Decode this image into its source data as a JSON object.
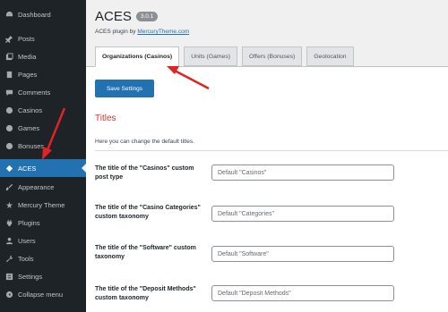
{
  "sidebar": {
    "items": [
      {
        "label": "Dashboard",
        "icon": "dashboard-icon",
        "active": false
      },
      {
        "label": "Posts",
        "icon": "pin-icon",
        "active": false
      },
      {
        "label": "Media",
        "icon": "media-icon",
        "active": false
      },
      {
        "label": "Pages",
        "icon": "pages-icon",
        "active": false
      },
      {
        "label": "Comments",
        "icon": "comments-icon",
        "active": false
      },
      {
        "label": "Casinos",
        "icon": "casinos-icon",
        "active": false
      },
      {
        "label": "Games",
        "icon": "games-icon",
        "active": false
      },
      {
        "label": "Bonuses",
        "icon": "bonuses-icon",
        "active": false
      },
      {
        "label": "ACES",
        "icon": "aces-icon",
        "active": true
      },
      {
        "label": "Appearance",
        "icon": "appearance-icon",
        "active": false
      },
      {
        "label": "Mercury Theme",
        "icon": "mercury-icon",
        "active": false
      },
      {
        "label": "Plugins",
        "icon": "plugins-icon",
        "active": false
      },
      {
        "label": "Users",
        "icon": "users-icon",
        "active": false
      },
      {
        "label": "Tools",
        "icon": "tools-icon",
        "active": false
      },
      {
        "label": "Settings",
        "icon": "settings-icon",
        "active": false
      },
      {
        "label": "Collapse menu",
        "icon": "collapse-icon",
        "active": false
      }
    ]
  },
  "header": {
    "title": "ACES",
    "version": "3.0.1",
    "byline_prefix": "ACES plugin by ",
    "byline_link": "MercuryTheme.com"
  },
  "tabs": [
    {
      "label": "Organizations (Casinos)",
      "active": true
    },
    {
      "label": "Units (Games)",
      "active": false
    },
    {
      "label": "Offers (Bonuses)",
      "active": false
    },
    {
      "label": "Geolocation",
      "active": false
    }
  ],
  "save_button": "Save Settings",
  "section": {
    "title": "Titles",
    "description": "Here you can change the default titles."
  },
  "rows": [
    {
      "label": "The title of the \"Casinos\" custom post type",
      "value": "Default \"Casinos\""
    },
    {
      "label": "The title of the \"Casino Categories\" custom taxonomy",
      "value": "Default \"Categories\""
    },
    {
      "label": "The title of the \"Software\" custom taxonomy",
      "value": "Default \"Software\""
    },
    {
      "label": "The title of the \"Deposit Methods\" custom taxonomy",
      "value": "Default \"Deposit Methods\""
    }
  ],
  "colors": {
    "accent": "#2271b1",
    "sidebar_bg": "#1d2327",
    "section_title": "#d63638",
    "annotation_arrow": "#e02424"
  }
}
